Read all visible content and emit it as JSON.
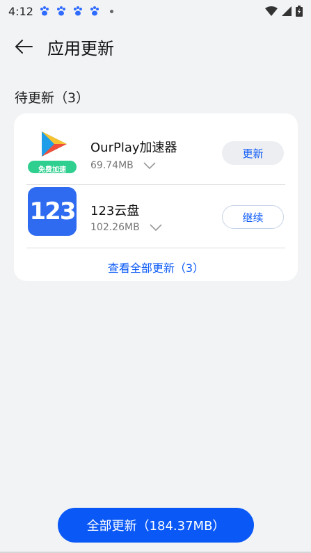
{
  "status_bar": {
    "time": "4:12",
    "notification_icons": [
      "baidu-paw-icon",
      "baidu-paw-icon",
      "baidu-paw-icon",
      "baidu-paw-icon"
    ],
    "right_icons": [
      "wifi-icon",
      "signal-icon",
      "battery-charging-icon"
    ]
  },
  "header": {
    "title": "应用更新"
  },
  "section": {
    "title": "待更新（3）"
  },
  "apps": [
    {
      "name": "OurPlay加速器",
      "size": "69.74MB",
      "badge": "免费加速",
      "action": "更新"
    },
    {
      "name": "123云盘",
      "size": "102.26MB",
      "icon_text": "123",
      "action": "继续"
    }
  ],
  "view_all": "查看全部更新（3）",
  "bottom_button": "全部更新（184.37MB）",
  "colors": {
    "accent": "#0a59f7",
    "background": "#f1f3f5",
    "card": "#ffffff"
  }
}
